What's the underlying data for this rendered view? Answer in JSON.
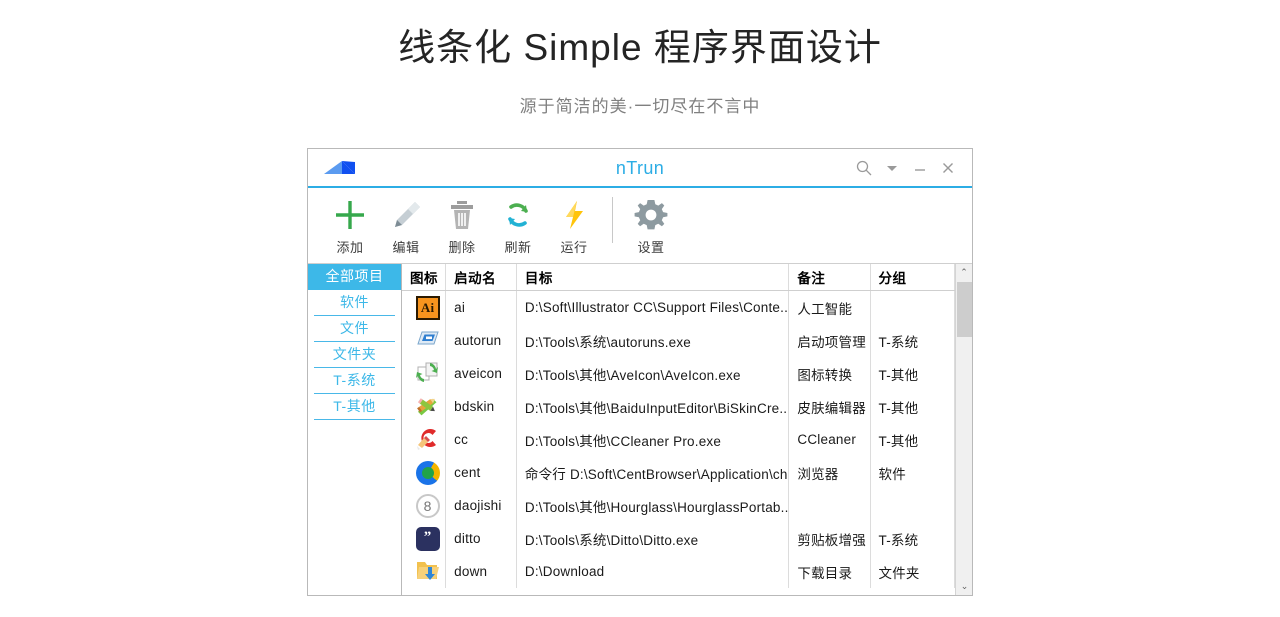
{
  "page": {
    "title": "线条化 Simple 程序界面设计",
    "subtitle": "源于简洁的美·一切尽在不言中"
  },
  "window": {
    "app_title": "nTrun",
    "logo_name": "ntrun-logo",
    "controls": [
      {
        "name": "search-icon",
        "label": "搜索"
      },
      {
        "name": "chevron-down-icon",
        "label": "更多"
      },
      {
        "name": "minimize-icon",
        "label": "最小化"
      },
      {
        "name": "close-icon",
        "label": "关闭"
      }
    ]
  },
  "toolbar": {
    "buttons": [
      {
        "label": "添加",
        "icon": "plus-icon",
        "color": "#36a84c"
      },
      {
        "label": "编辑",
        "icon": "pencil-icon",
        "color": "#9aa7ae"
      },
      {
        "label": "删除",
        "icon": "trash-icon",
        "color": "#9d9d9d"
      },
      {
        "label": "刷新",
        "icon": "refresh-icon",
        "color": "#22b2d4"
      },
      {
        "label": "运行",
        "icon": "lightning-icon",
        "color": "#ffc40a"
      },
      {
        "label": "设置",
        "icon": "gear-icon",
        "color": "#8d9aa0"
      }
    ]
  },
  "sidebar": {
    "items": [
      {
        "label": "全部项目",
        "active": true
      },
      {
        "label": "软件",
        "active": false
      },
      {
        "label": "文件",
        "active": false
      },
      {
        "label": "文件夹",
        "active": false
      },
      {
        "label": "T-系统",
        "active": false
      },
      {
        "label": "T-其他",
        "active": false
      }
    ]
  },
  "table": {
    "columns": [
      "图标",
      "启动名",
      "目标",
      "备注",
      "分组"
    ],
    "rows": [
      {
        "icon": "illustrator-icon",
        "name": "ai",
        "target": "D:\\Soft\\Illustrator CC\\Support Files\\Conte...",
        "note": "人工智能",
        "group": ""
      },
      {
        "icon": "autoruns-icon",
        "name": "autorun",
        "target": "D:\\Tools\\系统\\autoruns.exe",
        "note": "启动项管理",
        "group": "T-系统"
      },
      {
        "icon": "aveicon-icon",
        "name": "aveicon",
        "target": "D:\\Tools\\其他\\AveIcon\\AveIcon.exe",
        "note": "图标转换",
        "group": "T-其他"
      },
      {
        "icon": "bdskin-icon",
        "name": "bdskin",
        "target": "D:\\Tools\\其他\\BaiduInputEditor\\BiSkinCre...",
        "note": "皮肤编辑器",
        "group": "T-其他"
      },
      {
        "icon": "ccleaner-icon",
        "name": "cc",
        "target": "D:\\Tools\\其他\\CCleaner Pro.exe",
        "note": "CCleaner",
        "group": "T-其他"
      },
      {
        "icon": "centbrowser-icon",
        "name": "cent",
        "target": "命令行 D:\\Soft\\CentBrowser\\Application\\ch...",
        "note": "浏览器",
        "group": "软件"
      },
      {
        "icon": "hourglass-icon",
        "name": "daojishi",
        "target": "D:\\Tools\\其他\\Hourglass\\HourglassPortab...",
        "note": "",
        "group": ""
      },
      {
        "icon": "ditto-icon",
        "name": "ditto",
        "target": "D:\\Tools\\系统\\Ditto\\Ditto.exe",
        "note": "剪贴板增强",
        "group": "T-系统"
      },
      {
        "icon": "download-folder-icon",
        "name": "down",
        "target": "D:\\Download",
        "note": "下载目录",
        "group": "文件夹"
      }
    ]
  },
  "scrollbar": {
    "up_glyph": "⌃",
    "down_glyph": "⌄"
  },
  "colors": {
    "accent": "#2cade5",
    "sidebar_active_bg": "#3db8e8",
    "toolbar_add": "#36a84c",
    "toolbar_run": "#ffc40a"
  }
}
